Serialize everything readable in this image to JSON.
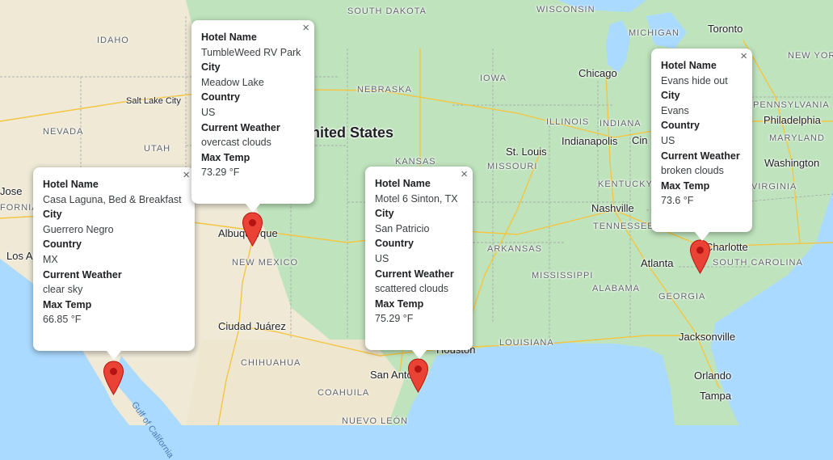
{
  "map": {
    "states": [
      "SOUTH DAKOTA",
      "WISCONSIN",
      "MICHIGAN",
      "IDAHO",
      "NEW YORK",
      "IOWA",
      "NEBRASKA",
      "NEVADA",
      "UTAH",
      "ILLINOIS",
      "INDIANA",
      "KANSAS",
      "MISSOURI",
      "KENTUCKY",
      "TENNESSEE",
      "ARKANSAS",
      "MISSISSIPPI",
      "ALABAMA",
      "GEORGIA",
      "SOUTH CAROLINA",
      "NEW MEXICO",
      "LOUISIANA",
      "CHIHUAHUA",
      "COAHUILA",
      "NUEVO LEÓN",
      "PENNSYLVANIA",
      "MARYLAND",
      "VIRGINIA",
      "FORNIA"
    ],
    "cities": [
      "Toronto",
      "Chicago",
      "Salt Lake City",
      "Philadelphia",
      "Indianapolis",
      "St. Louis",
      "Washington",
      "Nashville",
      "Charlotte",
      "Atlanta",
      "Albuquerque",
      "Los Ang",
      "Ciudad Juárez",
      "Houston",
      "San Antonio",
      "Jacksonville",
      "Orlando",
      "Tampa",
      "Cin",
      "Jose"
    ],
    "country": "United States",
    "water": "Gulf of California"
  },
  "markers": [
    {
      "id": "guerrero-negro",
      "color": "#ea4335"
    },
    {
      "id": "meadow-lake",
      "color": "#ea4335"
    },
    {
      "id": "san-patricio",
      "color": "#ea4335"
    },
    {
      "id": "evans",
      "color": "#ea4335"
    }
  ],
  "info_windows": [
    {
      "hotel_label": "Hotel Name",
      "hotel": "Casa Laguna, Bed & Breakfast",
      "city_label": "City",
      "city": "Guerrero Negro",
      "country_label": "Country",
      "country": "MX",
      "weather_label": "Current Weather",
      "weather": "clear sky",
      "temp_label": "Max Temp",
      "temp": "66.85 °F",
      "close": "×"
    },
    {
      "hotel_label": "Hotel Name",
      "hotel": "TumbleWeed RV Park",
      "city_label": "City",
      "city": "Meadow Lake",
      "country_label": "Country",
      "country": "US",
      "weather_label": "Current Weather",
      "weather": "overcast clouds",
      "temp_label": "Max Temp",
      "temp": "73.29 °F",
      "close": "×"
    },
    {
      "hotel_label": "Hotel Name",
      "hotel": "Motel 6 Sinton, TX",
      "city_label": "City",
      "city": "San Patricio",
      "country_label": "Country",
      "country": "US",
      "weather_label": "Current Weather",
      "weather": "scattered clouds",
      "temp_label": "Max Temp",
      "temp": "75.29 °F",
      "close": "×"
    },
    {
      "hotel_label": "Hotel Name",
      "hotel": "Evans hide out",
      "city_label": "City",
      "city": "Evans",
      "country_label": "Country",
      "country": "US",
      "weather_label": "Current Weather",
      "weather": "broken clouds",
      "temp_label": "Max Temp",
      "temp": "73.6 °F",
      "close": "×"
    }
  ]
}
